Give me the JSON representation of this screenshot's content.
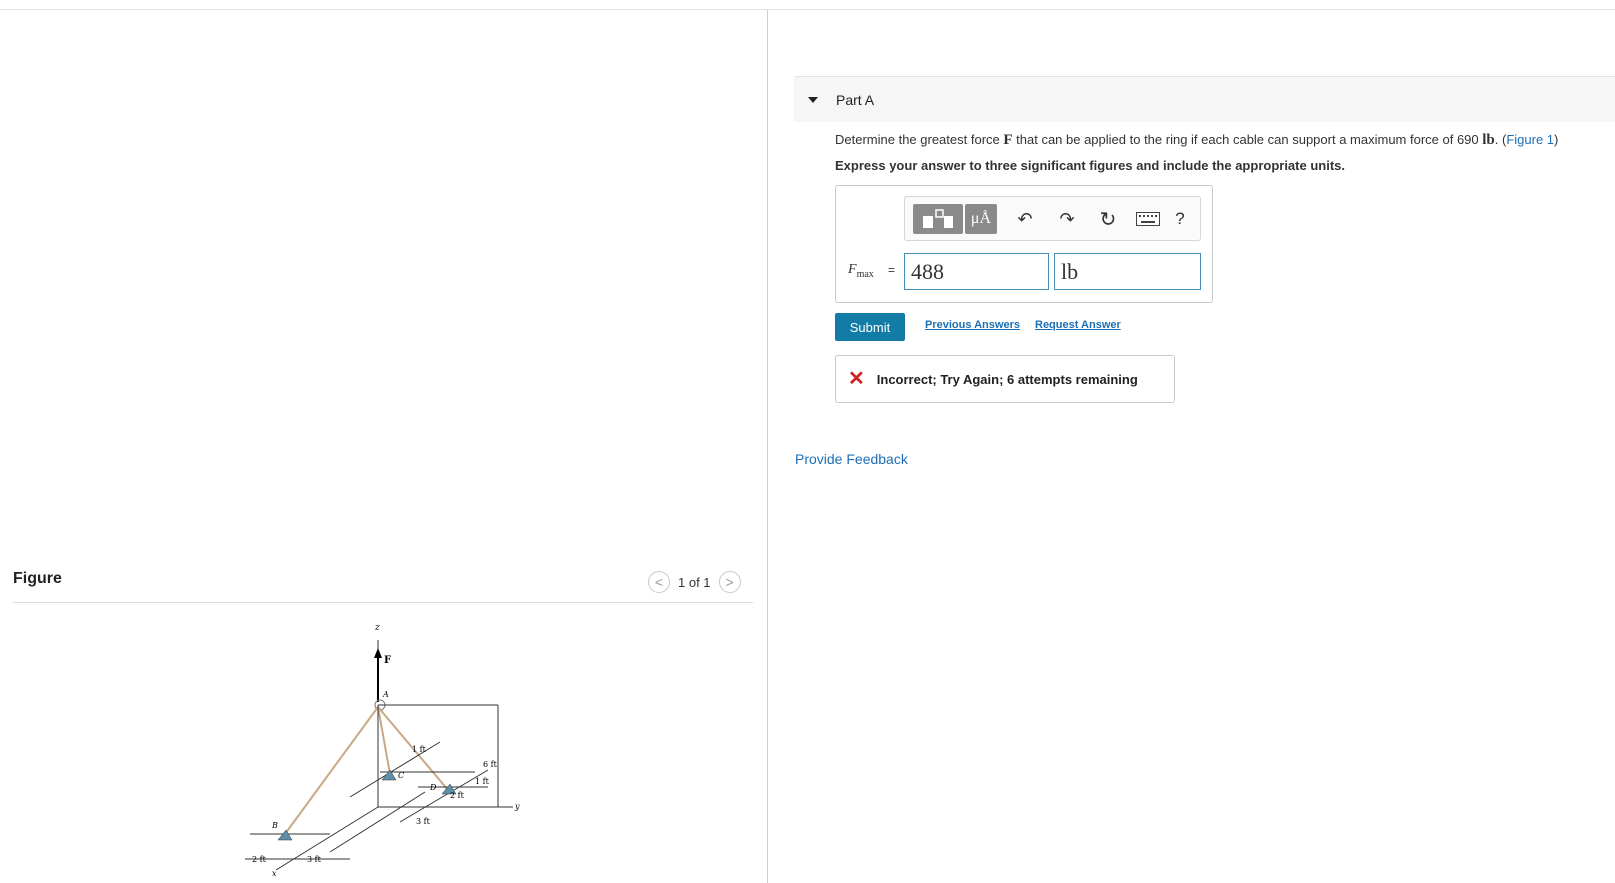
{
  "figure_panel": {
    "title": "Figure",
    "pager": {
      "text": "1 of 1",
      "prev_glyph": "<",
      "next_glyph": ">"
    },
    "diagram_labels": {
      "z": "z",
      "F": "F",
      "A": "A",
      "B": "B",
      "C": "C",
      "D": "D",
      "x": "x",
      "y": "y",
      "dim_1ft_top": "1 ft",
      "dim_6ft": "6 ft",
      "dim_1ft_right": "1 ft",
      "dim_2ft_mid": "2 ft",
      "dim_3ft_mid": "3 ft",
      "dim_2ft_bottom": "2 ft",
      "dim_3ft_bottom": "3 ft"
    }
  },
  "part": {
    "title": "Part A"
  },
  "question": {
    "prompt_before": "Determine the greatest force ",
    "prompt_force_symbol": "F",
    "prompt_middle": " that can be applied to the ring if each cable can support a maximum force of 690 ",
    "prompt_unit": "lb",
    "prompt_after": ". (",
    "figure_link": "Figure 1",
    "prompt_close": ")",
    "instructions": "Express your answer to three significant figures and include the appropriate units."
  },
  "answer": {
    "variable": "F",
    "variable_subscript": "max",
    "equals": "=",
    "value": "488",
    "unit": "lb"
  },
  "toolbar": {
    "units_label": "μÅ",
    "undo_icon": "↶",
    "redo_icon": "↷",
    "reset_icon": "↻",
    "help_label": "?"
  },
  "actions": {
    "submit": "Submit",
    "previous_answers": "Previous Answers",
    "request_answer": "Request Answer"
  },
  "feedback": {
    "icon": "✕",
    "message": "Incorrect; Try Again; 6 attempts remaining"
  },
  "provide_feedback": "Provide Feedback",
  "colors": {
    "link": "#1c6fb5",
    "submit_bg": "#127ca6",
    "error": "#d21f1f",
    "field_border": "#4a8fb8"
  }
}
